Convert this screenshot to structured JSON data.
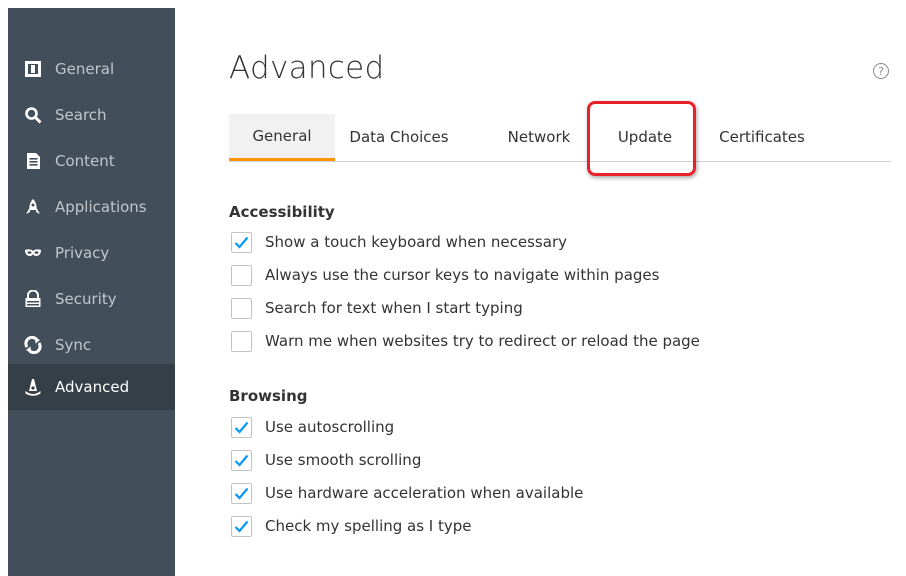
{
  "sidebar": {
    "items": [
      {
        "label": "General",
        "icon": "general-icon"
      },
      {
        "label": "Search",
        "icon": "search-icon"
      },
      {
        "label": "Content",
        "icon": "content-icon"
      },
      {
        "label": "Applications",
        "icon": "applications-icon"
      },
      {
        "label": "Privacy",
        "icon": "privacy-icon"
      },
      {
        "label": "Security",
        "icon": "security-icon"
      },
      {
        "label": "Sync",
        "icon": "sync-icon"
      },
      {
        "label": "Advanced",
        "icon": "advanced-icon",
        "selected": true
      }
    ]
  },
  "header": {
    "title": "Advanced",
    "help_glyph": "?"
  },
  "tabs": [
    {
      "label": "General",
      "selected": true
    },
    {
      "label": "Data Choices"
    },
    {
      "label": "Network"
    },
    {
      "label": "Update",
      "highlighted": true
    },
    {
      "label": "Certificates"
    }
  ],
  "accessibility": {
    "heading": "Accessibility",
    "options": [
      {
        "label": "Show a touch keyboard when necessary",
        "checked": true
      },
      {
        "label": "Always use the cursor keys to navigate within pages",
        "checked": false
      },
      {
        "label": "Search for text when I start typing",
        "checked": false
      },
      {
        "label": "Warn me when websites try to redirect or reload the page",
        "checked": false
      }
    ]
  },
  "browsing": {
    "heading": "Browsing",
    "options": [
      {
        "label": "Use autoscrolling",
        "checked": true
      },
      {
        "label": "Use smooth scrolling",
        "checked": true
      },
      {
        "label": "Use hardware acceleration when available",
        "checked": true
      },
      {
        "label": "Check my spelling as I type",
        "checked": true
      }
    ]
  },
  "colors": {
    "sidebar_bg": "#424f5a",
    "sidebar_active_bg": "#343f48",
    "tab_accent": "#ff9500",
    "highlight": "#e8202a",
    "check": "#0996f8"
  }
}
